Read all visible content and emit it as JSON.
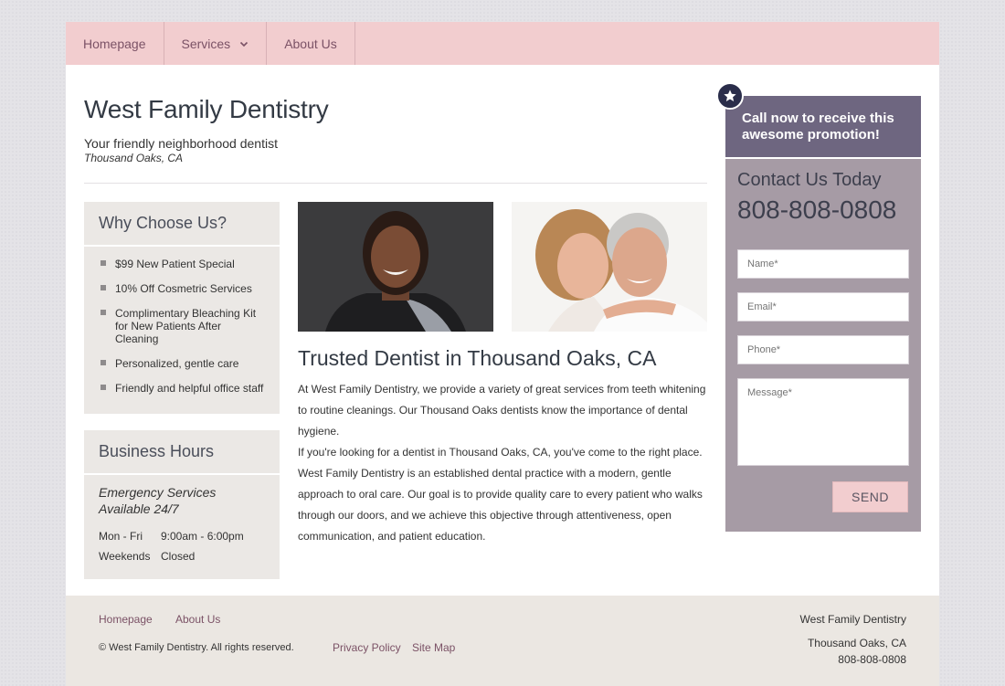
{
  "nav": {
    "items": [
      {
        "label": "Homepage"
      },
      {
        "label": "Services"
      },
      {
        "label": "About Us"
      }
    ]
  },
  "header": {
    "title": "West Family Dentistry",
    "tagline": "Your friendly neighborhood dentist",
    "location": "Thousand Oaks, CA"
  },
  "why": {
    "heading": "Why Choose Us?",
    "items": [
      "$99 New Patient Special",
      "10% Off Cosmetric Services",
      "Complimentary Bleaching Kit for New Patients After Cleaning",
      "Personalized, gentle care",
      "Friendly and helpful office staff"
    ]
  },
  "hours": {
    "heading": "Business Hours",
    "emergency": "Emergency Services Available 24/7",
    "rows": [
      {
        "day": "Mon - Fri",
        "time": "9:00am - 6:00pm"
      },
      {
        "day": "Weekends",
        "time": "Closed"
      }
    ]
  },
  "main": {
    "title": "Trusted Dentist in Thousand Oaks, CA",
    "paragraph1": "At West Family Dentistry, we provide a variety of great services from teeth whitening to routine cleanings. Our Thousand Oaks dentists know the importance of dental hygiene.",
    "paragraph2": "If you're looking for a dentist in Thousand Oaks, CA, you've come to the right place. West Family Dentistry is an established dental practice with a modern, gentle approach to oral care. Our goal is to provide quality care to every patient who walks through our doors, and we achieve this objective through attentiveness, open communication, and patient education."
  },
  "promo": {
    "text": "Call now to receive this awesome promotion!"
  },
  "contact": {
    "heading": "Contact Us Today",
    "phone": "808-808-0808",
    "name_placeholder": "Name*",
    "email_placeholder": "Email*",
    "phone_placeholder": "Phone*",
    "message_placeholder": "Message*",
    "send_label": "SEND"
  },
  "footer": {
    "links": {
      "home": "Homepage",
      "about": "About Us",
      "privacy": "Privacy Policy",
      "sitemap": "Site Map"
    },
    "copyright": "© West Family Dentistry. All rights reserved.",
    "business": "West Family Dentistry",
    "city": "Thousand Oaks, CA",
    "phone": "808-808-0808"
  },
  "colors": {
    "nav_bg": "#f2cdcf",
    "promo_bg": "#6e6680",
    "contact_bg": "#a69ba5",
    "panel_bg": "#ebe8e5",
    "link": "#7b5266"
  }
}
